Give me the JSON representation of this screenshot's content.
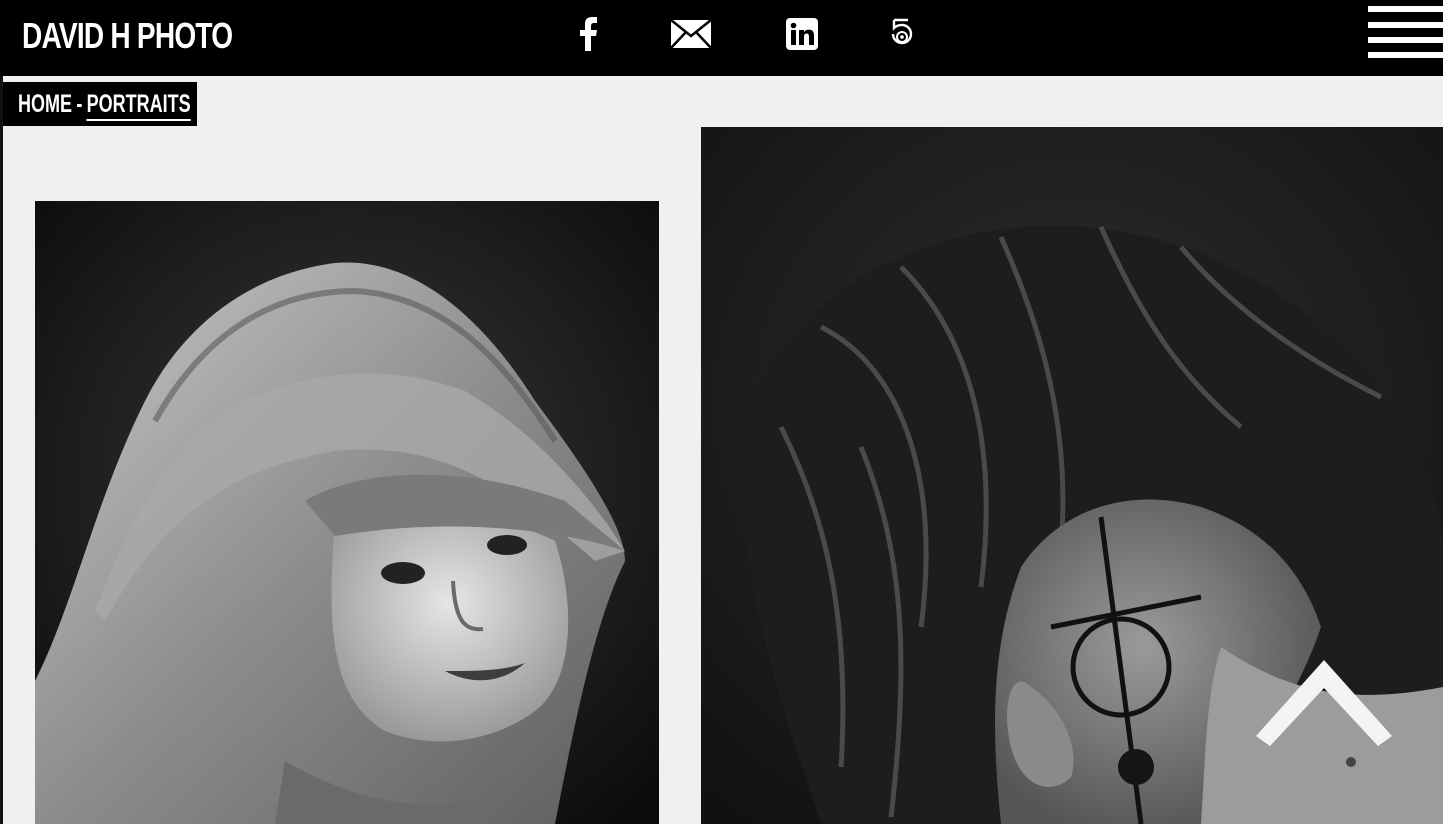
{
  "header": {
    "brand": "DAVID H PHOTO",
    "social": [
      {
        "icon": "facebook-icon"
      },
      {
        "icon": "email-icon"
      },
      {
        "icon": "linkedin-icon"
      },
      {
        "icon": "500px-icon"
      }
    ],
    "menu_icon": "hamburger-menu-icon"
  },
  "breadcrumb": {
    "home": "HOME",
    "separator": "-",
    "current": "PORTRAITS"
  },
  "gallery": {
    "photos": [
      {
        "subject": "woman-hood-portrait",
        "style": "black-and-white"
      },
      {
        "subject": "dreadlocks-tattoo-portrait",
        "style": "black-and-white"
      }
    ]
  },
  "back_to_top": {
    "icon": "chevron-up-icon"
  },
  "colors": {
    "background": "#f0f0f0",
    "bar": "#000000",
    "text": "#ffffff"
  }
}
